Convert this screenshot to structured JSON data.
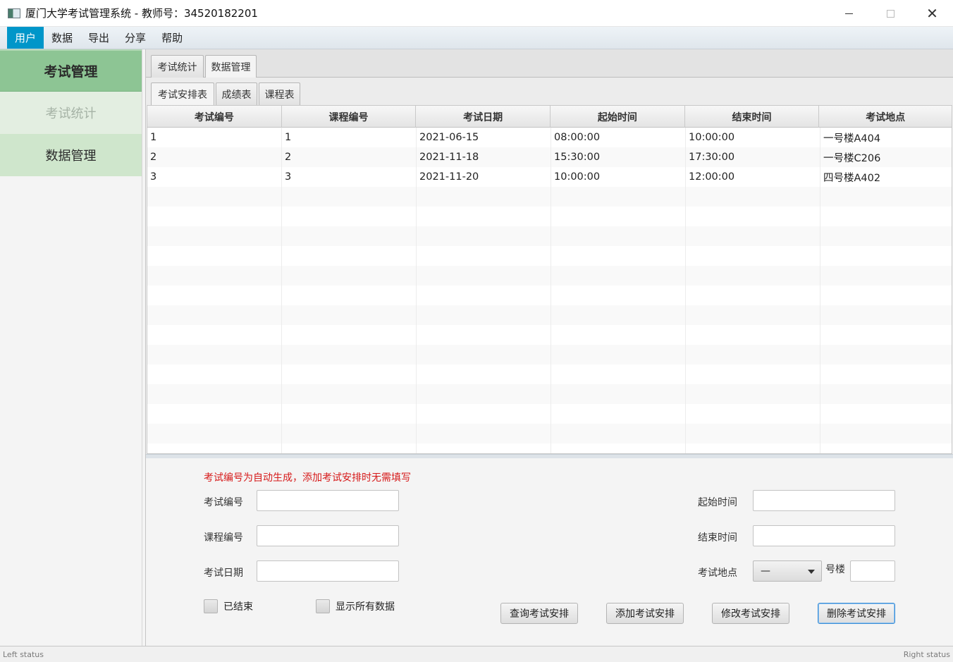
{
  "window": {
    "title": "厦门大学考试管理系统 - 教师号：34520182201"
  },
  "menu": [
    "用户",
    "数据",
    "导出",
    "分享",
    "帮助"
  ],
  "sidebar": {
    "header": "考试管理",
    "items": [
      "考试统计",
      "数据管理"
    ]
  },
  "outer_tabs": [
    "考试统计",
    "数据管理"
  ],
  "inner_tabs": [
    "考试安排表",
    "成绩表",
    "课程表"
  ],
  "table": {
    "columns": [
      "考试编号",
      "课程编号",
      "考试日期",
      "起始时间",
      "结束时间",
      "考试地点"
    ],
    "rows": [
      [
        "1",
        "1",
        "2021-06-15",
        "08:00:00",
        "10:00:00",
        "一号楼A404"
      ],
      [
        "2",
        "2",
        "2021-11-18",
        "15:30:00",
        "17:30:00",
        "一号楼C206"
      ],
      [
        "3",
        "3",
        "2021-11-20",
        "10:00:00",
        "12:00:00",
        "四号楼A402"
      ]
    ]
  },
  "form": {
    "notice": "考试编号为自动生成，添加考试安排时无需填写",
    "exam_id_label": "考试编号",
    "course_id_label": "课程编号",
    "exam_date_label": "考试日期",
    "start_time_label": "起始时间",
    "end_time_label": "结束时间",
    "location_label": "考试地点",
    "location_select_value": "—",
    "building_suffix": "号楼",
    "finished_label": "已结束",
    "show_all_label": "显示所有数据",
    "buttons": {
      "query": "查询考试安排",
      "add": "添加考试安排",
      "modify": "修改考试安排",
      "delete": "删除考试安排"
    }
  },
  "status": {
    "left": "Left status",
    "right": "Right status"
  }
}
